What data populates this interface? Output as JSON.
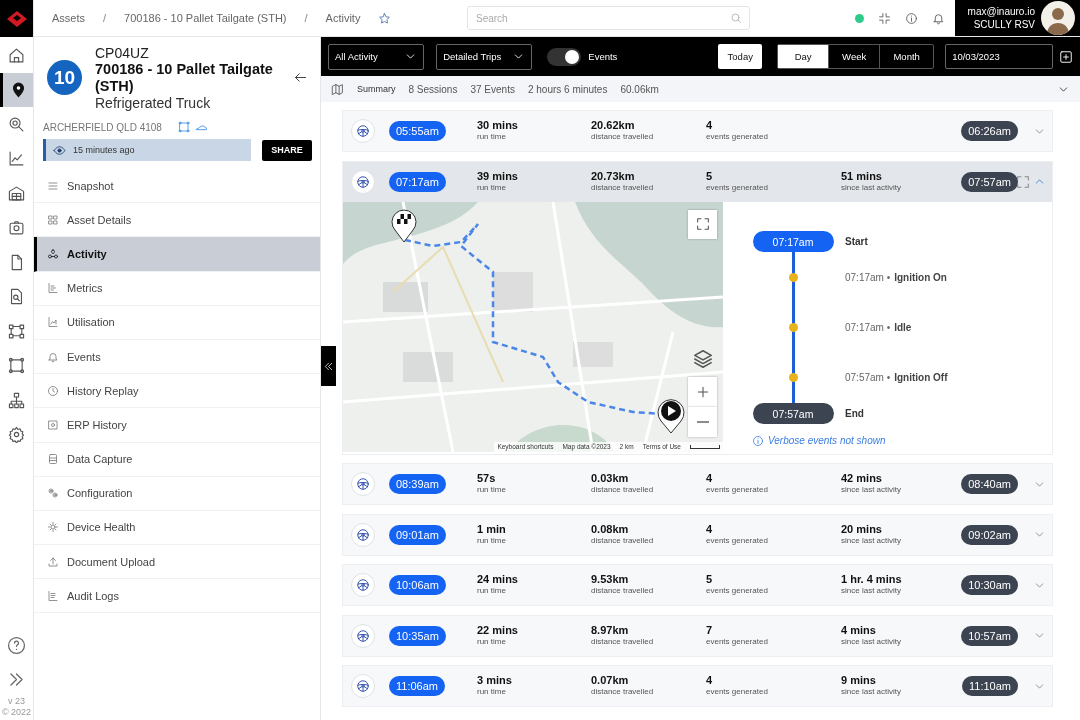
{
  "rail": {
    "items": [
      {
        "selected": false
      },
      {
        "selected": true
      },
      {
        "selected": false
      },
      {
        "selected": false
      },
      {
        "selected": false
      },
      {
        "selected": false
      },
      {
        "selected": false
      },
      {
        "selected": false
      },
      {
        "selected": false
      },
      {
        "selected": false
      },
      {
        "selected": false
      },
      {
        "selected": false
      }
    ],
    "version": "v 23",
    "copyright": "© 2022"
  },
  "breadcrumb": {
    "separator": "/",
    "items": [
      "Assets",
      "700186 - 10 Pallet Tailgate (STH)",
      "Activity"
    ]
  },
  "search": {
    "placeholder": "Search"
  },
  "connection": {
    "online": true
  },
  "user": {
    "email": "max@inauro.io",
    "org": "SCULLY RSV"
  },
  "asset": {
    "badge": "10",
    "code": "CP04UZ",
    "name": "700186 - 10 Pallet Tailgate (STH)",
    "type": "Refrigerated Truck",
    "location": "ARCHERFIELD QLD 4108",
    "last_seen": "15 minutes ago",
    "share": "SHARE"
  },
  "menu": [
    {
      "label": "Snapshot",
      "selected": false
    },
    {
      "label": "Asset Details",
      "selected": false
    },
    {
      "label": "Activity",
      "selected": true
    },
    {
      "label": "Metrics",
      "selected": false
    },
    {
      "label": "Utilisation",
      "selected": false
    },
    {
      "label": "Events",
      "selected": false
    },
    {
      "label": "History Replay",
      "selected": false
    },
    {
      "label": "ERP History",
      "selected": false
    },
    {
      "label": "Data Capture",
      "selected": false
    },
    {
      "label": "Configuration",
      "selected": false
    },
    {
      "label": "Device Health",
      "selected": false
    },
    {
      "label": "Document Upload",
      "selected": false
    },
    {
      "label": "Audit Logs",
      "selected": false
    }
  ],
  "toolbar": {
    "activity_filter": "All Activity",
    "trip_mode": "Detailed Trips",
    "events_toggle": {
      "label": "Events",
      "on": true
    },
    "today": "Today",
    "ranges": [
      {
        "label": "Day",
        "selected": true
      },
      {
        "label": "Week",
        "selected": false
      },
      {
        "label": "Month",
        "selected": false
      }
    ],
    "date": "10/03/2023"
  },
  "summary": {
    "title": "Summary",
    "items": [
      "8 Sessions",
      "37 Events",
      "2 hours 6 minutes",
      "60.06km"
    ]
  },
  "trips": [
    {
      "start": "05:55am",
      "end": "06:26am",
      "expanded": false,
      "stats": [
        {
          "value": "30 mins",
          "label": "run time"
        },
        {
          "value": "20.62km",
          "label": "distance travelled"
        },
        {
          "value": "4",
          "label": "events generated"
        }
      ]
    },
    {
      "start": "07:17am",
      "end": "07:57am",
      "expanded": true,
      "stats": [
        {
          "value": "39 mins",
          "label": "run time"
        },
        {
          "value": "20.73km",
          "label": "distance travelled"
        },
        {
          "value": "5",
          "label": "events generated"
        },
        {
          "value": "51 mins",
          "label": "since last activity"
        }
      ],
      "detail": {
        "map": {
          "kind": "picture",
          "attribution": [
            "Keyboard shortcuts",
            "Map data ©2023",
            "2 km",
            "Terms of Use"
          ]
        },
        "timeline": [
          {
            "kind": "start",
            "time": "07:17am",
            "label": "Start"
          },
          {
            "kind": "event",
            "time": "07:17am",
            "bullet": "•",
            "label": "Ignition On"
          },
          {
            "kind": "event",
            "time": "07:17am",
            "bullet": "•",
            "label": "Idle"
          },
          {
            "kind": "event",
            "time": "07:57am",
            "bullet": "•",
            "label": "Ignition Off"
          },
          {
            "kind": "end",
            "time": "07:57am",
            "label": "End"
          }
        ],
        "note": "Verbose events not shown"
      }
    },
    {
      "start": "08:39am",
      "end": "08:40am",
      "expanded": false,
      "stats": [
        {
          "value": "57s",
          "label": "run time"
        },
        {
          "value": "0.03km",
          "label": "distance travelled"
        },
        {
          "value": "4",
          "label": "events generated"
        },
        {
          "value": "42 mins",
          "label": "since last activity"
        }
      ]
    },
    {
      "start": "09:01am",
      "end": "09:02am",
      "expanded": false,
      "stats": [
        {
          "value": "1 min",
          "label": "run time"
        },
        {
          "value": "0.08km",
          "label": "distance travelled"
        },
        {
          "value": "4",
          "label": "events generated"
        },
        {
          "value": "20 mins",
          "label": "since last activity"
        }
      ]
    },
    {
      "start": "10:06am",
      "end": "10:30am",
      "expanded": false,
      "stats": [
        {
          "value": "24 mins",
          "label": "run time"
        },
        {
          "value": "9.53km",
          "label": "distance travelled"
        },
        {
          "value": "5",
          "label": "events generated"
        },
        {
          "value": "1 hr. 4 mins",
          "label": "since last activity"
        }
      ]
    },
    {
      "start": "10:35am",
      "end": "10:57am",
      "expanded": false,
      "stats": [
        {
          "value": "22 mins",
          "label": "run time"
        },
        {
          "value": "8.97km",
          "label": "distance travelled"
        },
        {
          "value": "7",
          "label": "events generated"
        },
        {
          "value": "4 mins",
          "label": "since last activity"
        }
      ]
    },
    {
      "start": "11:06am",
      "end": "11:10am",
      "expanded": false,
      "stats": [
        {
          "value": "3 mins",
          "label": "run time"
        },
        {
          "value": "0.07km",
          "label": "distance travelled"
        },
        {
          "value": "4",
          "label": "events generated"
        },
        {
          "value": "9 mins",
          "label": "since last activity"
        }
      ]
    }
  ]
}
